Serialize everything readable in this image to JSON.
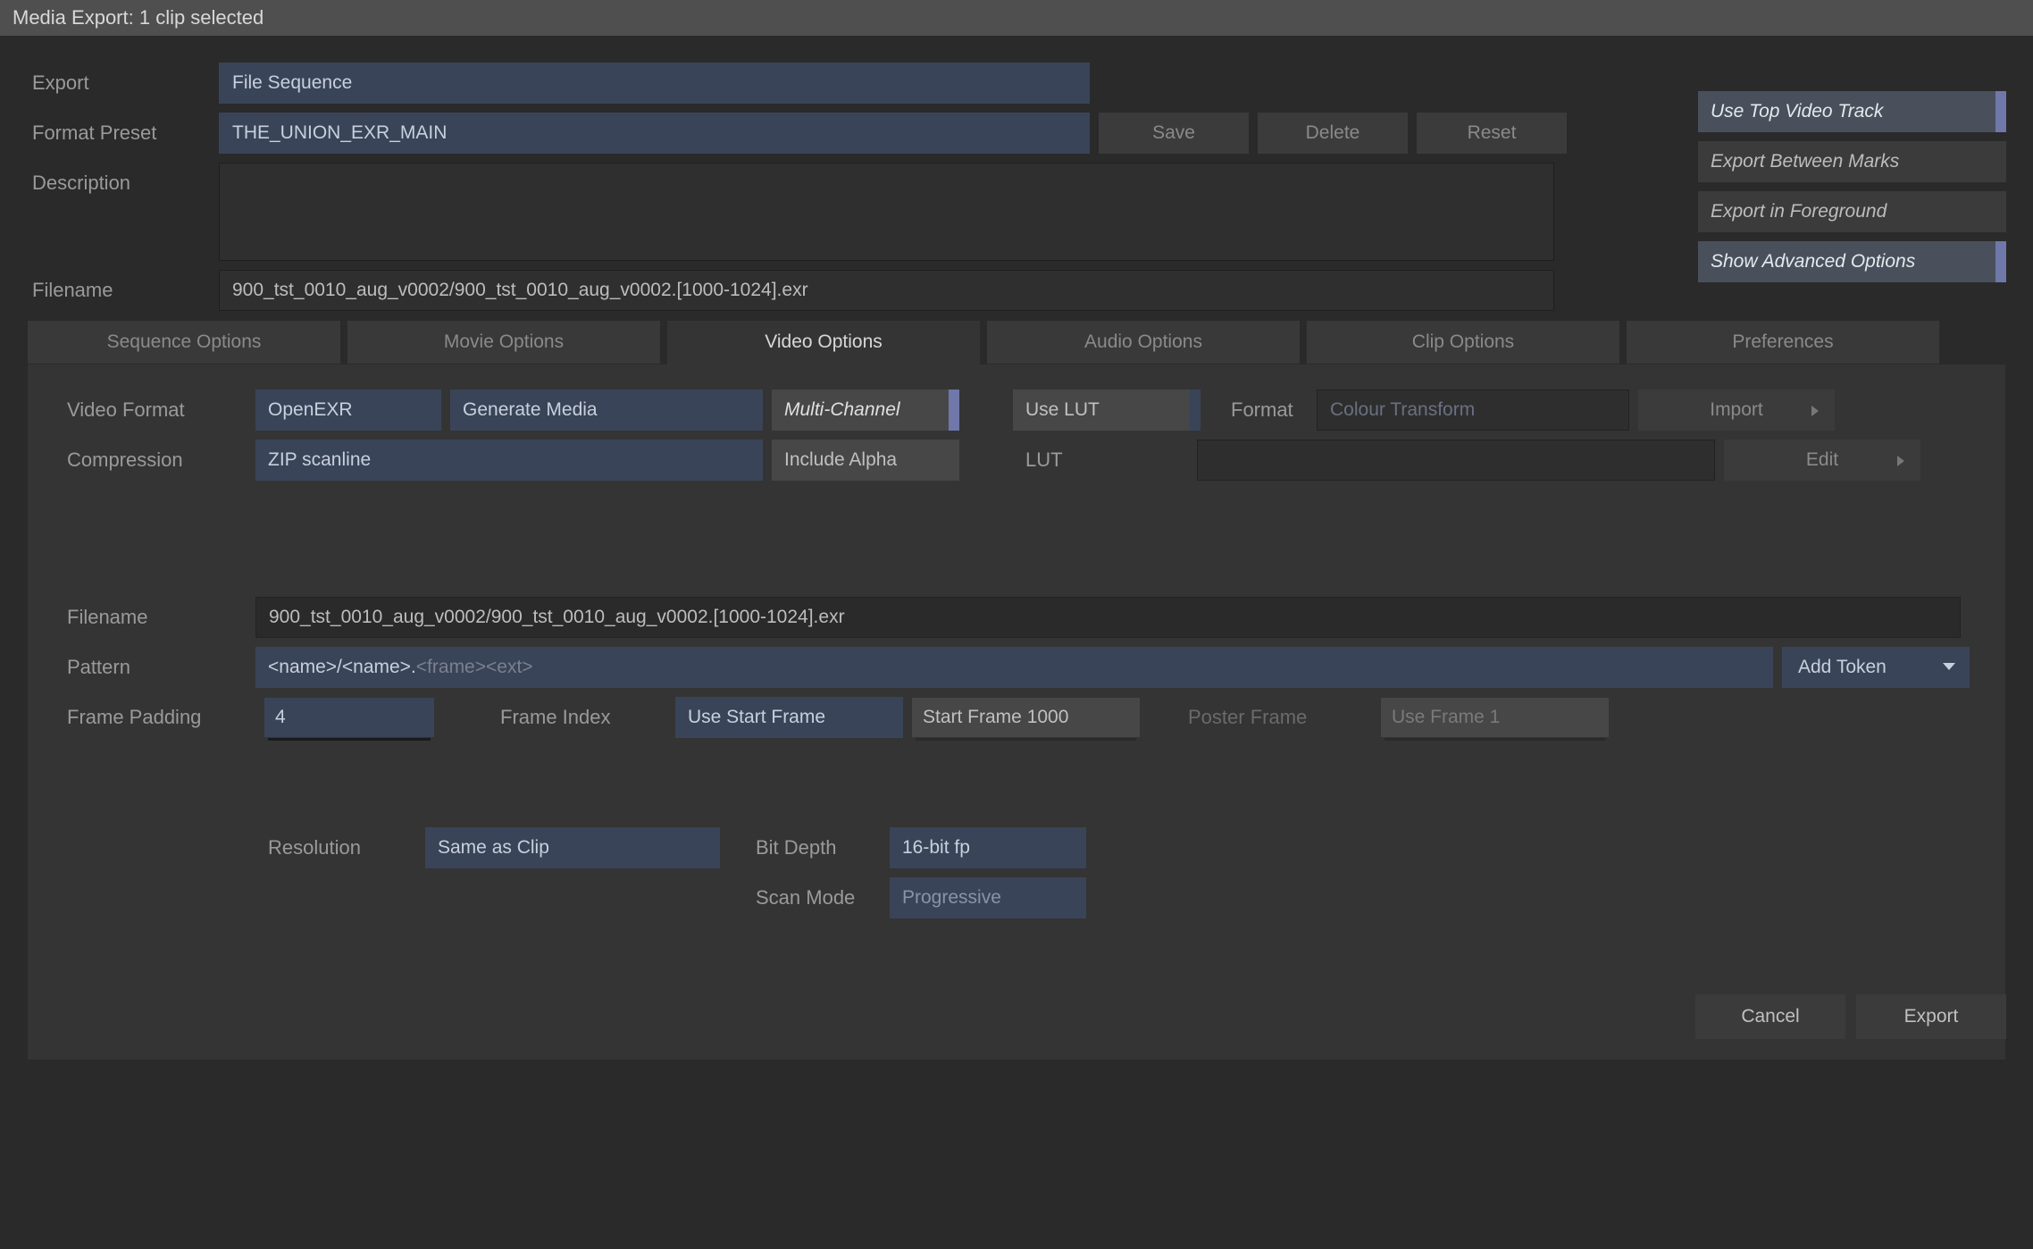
{
  "titlebar": "Media Export: 1 clip selected",
  "header": {
    "export_label": "Export",
    "export_value": "File Sequence",
    "preset_label": "Format Preset",
    "preset_value": "THE_UNION_EXR_MAIN",
    "save": "Save",
    "delete": "Delete",
    "reset": "Reset",
    "description_label": "Description",
    "filename_label": "Filename",
    "filename_value": "900_tst_0010_aug_v0002/900_tst_0010_aug_v0002.[1000-1024].exr"
  },
  "toggles": {
    "use_top": "Use Top Video Track",
    "between_marks": "Export Between Marks",
    "foreground": "Export in Foreground",
    "advanced": "Show Advanced Options"
  },
  "tabs": {
    "sequence": "Sequence Options",
    "movie": "Movie Options",
    "video": "Video Options",
    "audio": "Audio Options",
    "clip": "Clip Options",
    "prefs": "Preferences"
  },
  "video": {
    "format_label": "Video Format",
    "format_value": "OpenEXR",
    "generate_media": "Generate Media",
    "multi_channel": "Multi-Channel",
    "use_lut": "Use LUT",
    "format2_label": "Format",
    "colour_transform_ph": "Colour Transform",
    "import": "Import",
    "compression_label": "Compression",
    "compression_value": "ZIP scanline",
    "include_alpha": "Include Alpha",
    "lut_label": "LUT",
    "edit": "Edit",
    "filename_label": "Filename",
    "filename_value": "900_tst_0010_aug_v0002/900_tst_0010_aug_v0002.[1000-1024].exr",
    "pattern_label": "Pattern",
    "pattern_tokens": "<name>/<name>.",
    "pattern_faded": "<frame><ext>",
    "add_token": "Add Token",
    "frame_padding_label": "Frame Padding",
    "frame_padding_value": "4",
    "frame_index_label": "Frame Index",
    "use_start_frame": "Use Start Frame",
    "start_frame": "Start Frame 1000",
    "poster_frame_label": "Poster Frame",
    "use_frame": "Use Frame 1",
    "resolution_label": "Resolution",
    "resolution_value": "Same as Clip",
    "bit_depth_label": "Bit Depth",
    "bit_depth_value": "16-bit fp",
    "scan_mode_label": "Scan Mode",
    "scan_mode_value": "Progressive"
  },
  "footer": {
    "cancel": "Cancel",
    "export": "Export"
  }
}
